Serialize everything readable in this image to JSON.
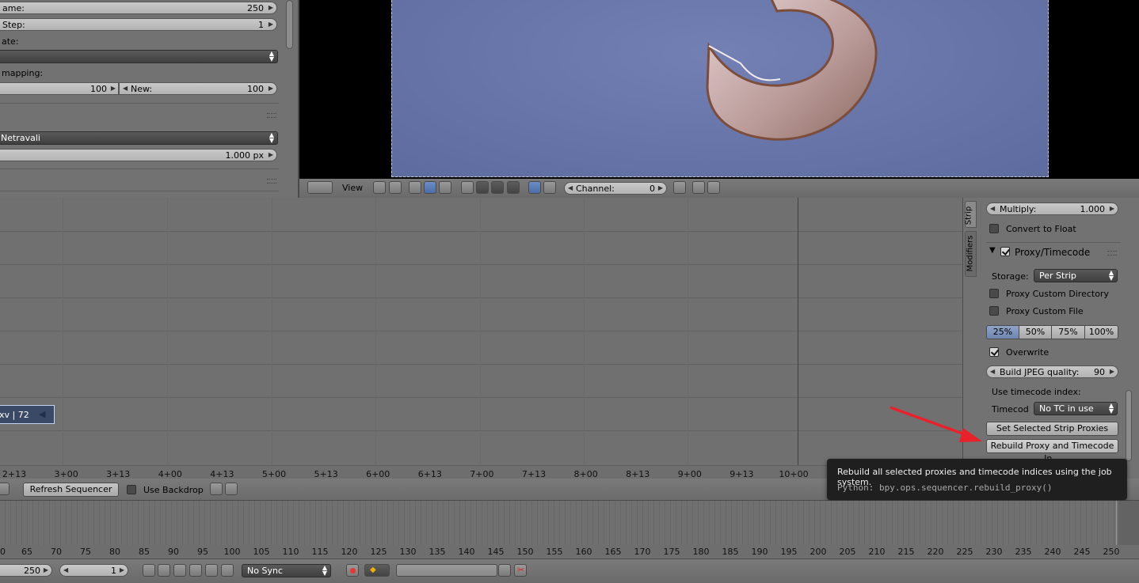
{
  "properties_panel": {
    "frame_end_label": "ame:",
    "frame_end_value": "250",
    "frame_step_label": "Step:",
    "frame_step_value": "1",
    "frame_rate_label": "ate:",
    "time_remapping_label": "mapping:",
    "old_value": "100",
    "new_label": "New:",
    "new_value": "100",
    "filter_value": "Netravali",
    "filter_size_value": "1.000 px"
  },
  "preview_header": {
    "view_menu": "View",
    "channel_label": "Channel:",
    "channel_value": "0"
  },
  "sequencer": {
    "strip_label": "xv | 72",
    "time_ticks": [
      "2+13",
      "3+00",
      "3+13",
      "4+00",
      "4+13",
      "5+00",
      "5+13",
      "6+00",
      "6+13",
      "7+00",
      "7+13",
      "8+00",
      "8+13",
      "9+00",
      "9+13",
      "10+00"
    ],
    "refresh_button": "Refresh Sequencer",
    "use_backdrop_label": "Use Backdrop"
  },
  "strip_panel": {
    "tabs": [
      "Strip",
      "Modifiers"
    ],
    "multiply_label": "Multiply:",
    "multiply_value": "1.000",
    "convert_float_label": "Convert to Float",
    "proxy_section_title": "Proxy/Timecode",
    "storage_label": "Storage:",
    "storage_value": "Per Strip",
    "proxy_custom_dir_label": "Proxy Custom Directory",
    "proxy_custom_file_label": "Proxy Custom File",
    "sizes": [
      "25%",
      "50%",
      "75%",
      "100%"
    ],
    "overwrite_label": "Overwrite",
    "jpeg_quality_label": "Build JPEG quality:",
    "jpeg_quality_value": "90",
    "use_timecode_label": "Use timecode index:",
    "timecode_label": "Timecod",
    "timecode_value": "No TC in use",
    "set_selected_button": "Set Selected Strip Proxies",
    "rebuild_button": "Rebuild Proxy and Timecode In..."
  },
  "tooltip": {
    "text": "Rebuild all selected proxies and timecode indices using the job system.",
    "python": "Python: bpy.ops.sequencer.rebuild_proxy()"
  },
  "timeline": {
    "frame_ticks": [
      "0",
      "65",
      "70",
      "75",
      "80",
      "85",
      "90",
      "95",
      "100",
      "105",
      "110",
      "115",
      "120",
      "125",
      "130",
      "135",
      "140",
      "145",
      "150",
      "155",
      "160",
      "165",
      "170",
      "175",
      "180",
      "185",
      "190",
      "195",
      "200",
      "205",
      "210",
      "215",
      "220",
      "225",
      "230",
      "235",
      "240",
      "245",
      "250"
    ],
    "end_value": "250",
    "current_value": "1",
    "sync_value": "No Sync"
  },
  "colors": {
    "arrow": "#e8212b",
    "preview_bg": "#6675a8",
    "strip_bg": "#3a4a66"
  }
}
